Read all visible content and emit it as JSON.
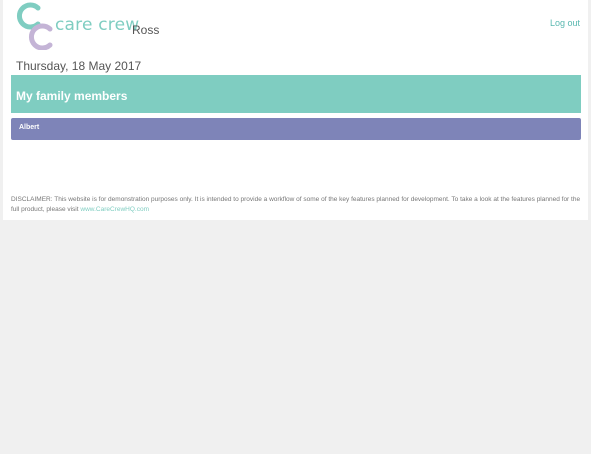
{
  "header": {
    "brand": "care crew",
    "username": "Ross",
    "logout_label": "Log out"
  },
  "main": {
    "date": "Thursday, 18 May 2017",
    "section_title": "My family members",
    "members": [
      "Albert"
    ]
  },
  "footer": {
    "disclaimer_text": "DISCLAIMER: This website is for demonstration purposes only. It is intended to provide a workflow of some of the key features planned for development. To take a look at the features planned for the full product, please visit ",
    "disclaimer_link": "www.CareCrewHQ.com"
  },
  "colors": {
    "brand_teal": "#7fcdc1",
    "brand_lilac": "#c4b4d6",
    "member_purple": "#7e84b8",
    "background": "#f0f0f0"
  },
  "icons": {
    "logo": "care-crew-logo-icon"
  }
}
